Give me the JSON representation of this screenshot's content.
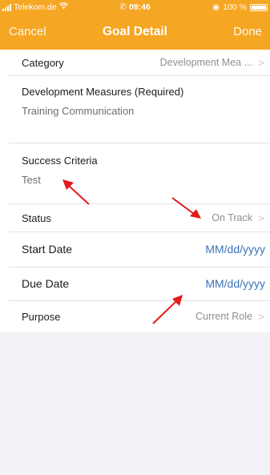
{
  "status_bar": {
    "carrier": "Telekom.de",
    "time": "09:46",
    "battery": "100 %",
    "color": "#f5a623"
  },
  "nav": {
    "cancel_label": "Cancel",
    "title": "Goal Detail",
    "done_label": "Done"
  },
  "form": {
    "category": {
      "label": "Category",
      "value": "Development Mea ..."
    },
    "development_measures": {
      "label": "Development Measures (Required)",
      "value": "Training Communication"
    },
    "success_criteria": {
      "label": "Success Criteria",
      "value": "Test"
    },
    "status": {
      "label": "Status",
      "value": "On Track"
    },
    "start_date": {
      "label": "Start Date",
      "placeholder": "MM/dd/yyyy"
    },
    "due_date": {
      "label": "Due Date",
      "placeholder": "MM/dd/yyyy"
    },
    "purpose": {
      "label": "Purpose",
      "value": "Current Role"
    }
  },
  "colors": {
    "accent": "#f5a623",
    "link": "#3b73b9",
    "annotation": "#e21b1b"
  },
  "icons": {
    "chevron": "chevron-right-icon",
    "signal": "signal-icon",
    "wifi": "wifi-icon",
    "phone": "phone-icon",
    "location": "location-icon",
    "battery": "battery-icon"
  }
}
